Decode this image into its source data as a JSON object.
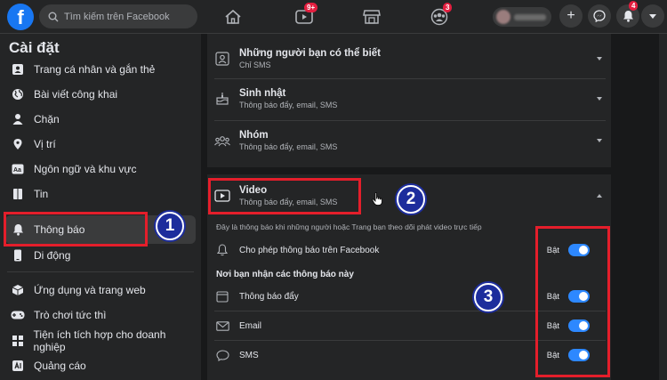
{
  "topbar": {
    "search_placeholder": "Tìm kiếm trên Facebook",
    "video_badge": "9+",
    "groups_badge": "3",
    "notif_badge": "4"
  },
  "sidebar": {
    "title": "Cài đặt",
    "items": [
      {
        "label": "Trang cá nhân và gắn thẻ",
        "icon": "profile-tag-icon"
      },
      {
        "label": "Bài viết công khai",
        "icon": "globe-icon"
      },
      {
        "label": "Chặn",
        "icon": "block-user-icon"
      },
      {
        "label": "Vị trí",
        "icon": "location-pin-icon"
      },
      {
        "label": "Ngôn ngữ và khu vực",
        "icon": "language-icon"
      },
      {
        "label": "Tin",
        "icon": "book-icon"
      },
      {
        "label": "Thông báo",
        "icon": "bell-icon"
      },
      {
        "label": "Di động",
        "icon": "mobile-icon"
      },
      {
        "label": "Ứng dụng và trang web",
        "icon": "apps-cube-icon"
      },
      {
        "label": "Trò chơi tức thì",
        "icon": "gamepad-icon"
      },
      {
        "label": "Tiện ích tích hợp cho doanh nghiệp",
        "icon": "business-integration-icon"
      },
      {
        "label": "Quảng cáo",
        "icon": "ads-icon"
      }
    ]
  },
  "main": {
    "rows": [
      {
        "title": "Những người bạn có thể biết",
        "subtitle": "Chỉ SMS"
      },
      {
        "title": "Sinh nhật",
        "subtitle": "Thông báo đẩy, email, SMS"
      },
      {
        "title": "Nhóm",
        "subtitle": "Thông báo đẩy, email, SMS"
      }
    ],
    "video": {
      "title": "Video",
      "subtitle": "Thông báo đẩy, email, SMS",
      "description": "Đây là thông báo khi những người hoặc Trang bạn theo dõi phát video trực tiếp",
      "allow_label": "Cho phép thông báo trên Facebook",
      "receive_heading": "Nơi bạn nhận các thông báo này",
      "channels": [
        {
          "label": "Thông báo đẩy",
          "icon": "push-window-icon"
        },
        {
          "label": "Email",
          "icon": "envelope-icon"
        },
        {
          "label": "SMS",
          "icon": "chat-bubble-icon"
        }
      ],
      "on_label": "Bật"
    }
  },
  "annotations": {
    "step1": "1",
    "step2": "2",
    "step3": "3",
    "highlight_color": "#e41e2b",
    "marker_color": "#1d2d9c"
  }
}
